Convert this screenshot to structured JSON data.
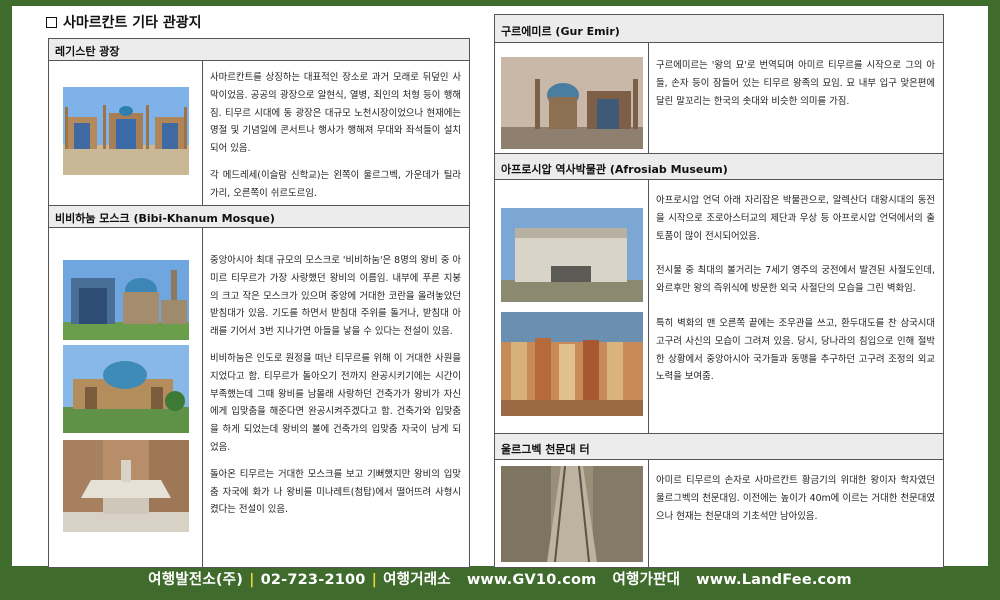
{
  "title": "사마르칸트 기타 관광지",
  "registan": {
    "heading": "레기스탄 광장",
    "p1": "사마르칸트를 상징하는 대표적인 장소로 과거 모래로 뒤덮인 사막이었음. 공공의 광장으로 알현식, 열병, 죄인의 처형 등이 행해짐. 티무르 시대에 동 광장은 대규모 노천시장이었으나 현재에는 명절 및 기념일에 콘서트나 행사가 행해져 무대와 좌석들이 설치되어 있음.",
    "p2": "각 메드레세(이슬람 신학교)는 왼쪽이 울르그벡, 가운데가 틸라가리, 오른쪽이 쉬르도르임."
  },
  "bibi": {
    "heading": "비비하눔 모스크 (Bibi-Khanum Mosque)",
    "p1": "중앙아시아 최대 규모의 모스크로 '비비하눔'은 8명의 왕비 중 아미르 티무르가 가장 사랑했던 왕비의 이름임. 내부에 푸른 지붕의 크고 작은 모스크가 있으며 중앙에 거대한 코란을 올려놓았던 받침대가 있음. 기도를 하면서 받침대 주위를 돌거나, 받침대 아래를 기어서 3번 지나가면 아들을 낳을 수 있다는 전설이 있음.",
    "p2": "비비하눔은 인도로 원정을 떠난 티무르를 위해 이 거대한 사원을 지었다고 함. 티무르가 돌아오기 전까지 완공시키기에는 시간이 부족했는데 그때 왕비를 남몰래 사랑하던 건축가가 왕비가 자신에게 입맞춤을 해준다면 완공시켜주겠다고 함. 건축가와 입맞춤을 하게 되었는데 왕비의 볼에 건축가의 입맞춤 자국이 남게 되었음.",
    "p3": "돌아온 티무르는 거대한 모스크를 보고 기뻐했지만 왕비의 입맞춤 자국에 화가 나 왕비를 미나레트(첨탑)에서 떨어뜨려 사형시켰다는 전설이 있음."
  },
  "gur": {
    "heading": "구르에미르 (Gur Emir)",
    "p1": "구르에미르는 '왕의 묘'로 번역되며 아미르 티무르를 시작으로 그의 아들, 손자 등이 잠들어 있는 티무르 왕족의 묘임. 묘 내부 입구 맞은편에 달린 말꼬리는 한국의 솟대와 비슷한 의미를 가짐."
  },
  "afro": {
    "heading": "아프로시압 역사박물관 (Afrosiab Museum)",
    "p1": "아프로시압 언덕 아래 자리잡은 박물관으로, 알렉산더 대왕시대의 동전을 시작으로 조로아스터교의 제단과 우상 등 아프로시압 언덕에서의 출토품이 많이 전시되어있음.",
    "p2": "전시물 중 최대의 볼거리는 7세기 영주의 궁전에서 발견된 사절도인데, 와르후만 왕의 즉위식에 방문한 외국 사절단의 모습을 그린 벽화임.",
    "p3": "특히 벽화의 맨 오른쪽 끝에는 조우관을 쓰고, 환두대도를 찬 삼국시대 고구려 사신의 모습이 그려져 있음. 당시, 당나라의 침입으로 인해 절박한 상황에서 중앙아시아 국가들과 동맹을 추구하던 고구려 조정의 외교 노력을 보여줌."
  },
  "ulugh": {
    "heading": "울르그벡 천문대 터",
    "p1": "아미르 티무르의 손자로 사마르칸트 황금기의 위대한 왕이자 학자였던 울르그벡의 천문대임. 이전에는 높이가 40m에 이르는 거대한 천문대였으나 현재는 천문대의 기초석만 남아있음."
  },
  "footer": {
    "company": "여행발전소(주)",
    "phone": "02-723-2100",
    "label1": "여행거래소",
    "url1": "www.GV10.com",
    "label2": "여행가판대",
    "url2": "www.LandFee.com",
    "sep": "|"
  }
}
